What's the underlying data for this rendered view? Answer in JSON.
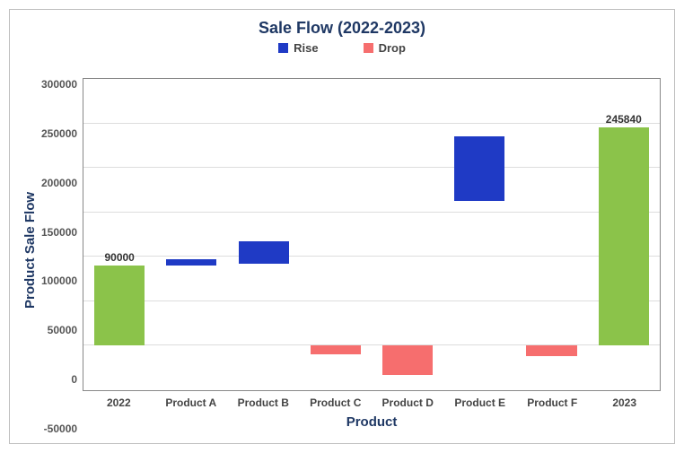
{
  "chart_data": {
    "type": "bar",
    "title": "Sale Flow (2022-2023)",
    "xlabel": "Product",
    "ylabel": "Product Sale Flow",
    "ylim": [
      -50000,
      300000
    ],
    "y_ticks": [
      -50000,
      0,
      50000,
      100000,
      150000,
      200000,
      250000,
      300000
    ],
    "legend": [
      {
        "name": "Rise",
        "color": "#1f3ac5"
      },
      {
        "name": "Drop",
        "color": "#f66e6e"
      }
    ],
    "categories": [
      "2022",
      "Product A",
      "Product B",
      "Product C",
      "Product D",
      "Product E",
      "Product F",
      "2023"
    ],
    "colors": {
      "total": "#8bc34a",
      "rise": "#1f3ac5",
      "drop": "#f66e6e"
    },
    "bars": [
      {
        "kind": "total",
        "bottom": 0,
        "top": 90000,
        "label": "90000"
      },
      {
        "kind": "rise",
        "bottom": 90000,
        "top": 97000
      },
      {
        "kind": "rise",
        "bottom": 92000,
        "top": 117000
      },
      {
        "kind": "drop",
        "bottom": -10000,
        "top": 0
      },
      {
        "kind": "drop",
        "bottom": -33000,
        "top": 0
      },
      {
        "kind": "rise",
        "bottom": 163000,
        "top": 235000
      },
      {
        "kind": "drop",
        "bottom": -12000,
        "top": 0
      },
      {
        "kind": "total",
        "bottom": 0,
        "top": 245840,
        "label": "245840"
      }
    ]
  }
}
